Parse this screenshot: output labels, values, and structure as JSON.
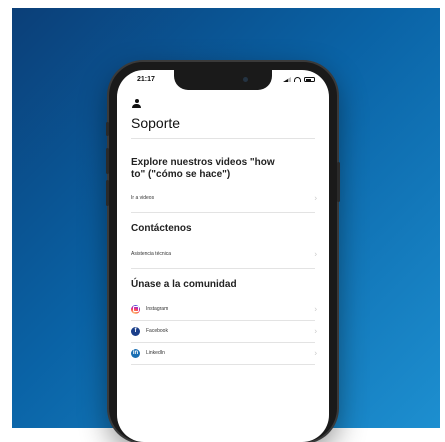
{
  "status_bar": {
    "time": "21:17"
  },
  "header": {
    "title": "Soporte"
  },
  "sections": {
    "videos": {
      "title": "Explore nuestros videos \"how to\" (\"cómo se hace\")",
      "link": "Ir a videos"
    },
    "contact": {
      "title": "Contáctenos",
      "link": "Asistencia técnica"
    },
    "community": {
      "title": "Únase a la comunidad",
      "items": [
        {
          "label": "Instagram",
          "icon": "instagram-icon"
        },
        {
          "label": "Facebook",
          "icon": "facebook-icon"
        },
        {
          "label": "LinkedIn",
          "icon": "linkedin-icon"
        }
      ]
    }
  },
  "chevron": "›",
  "colors": {
    "background": "#0a63a6",
    "phone": "#1a1a1a"
  }
}
